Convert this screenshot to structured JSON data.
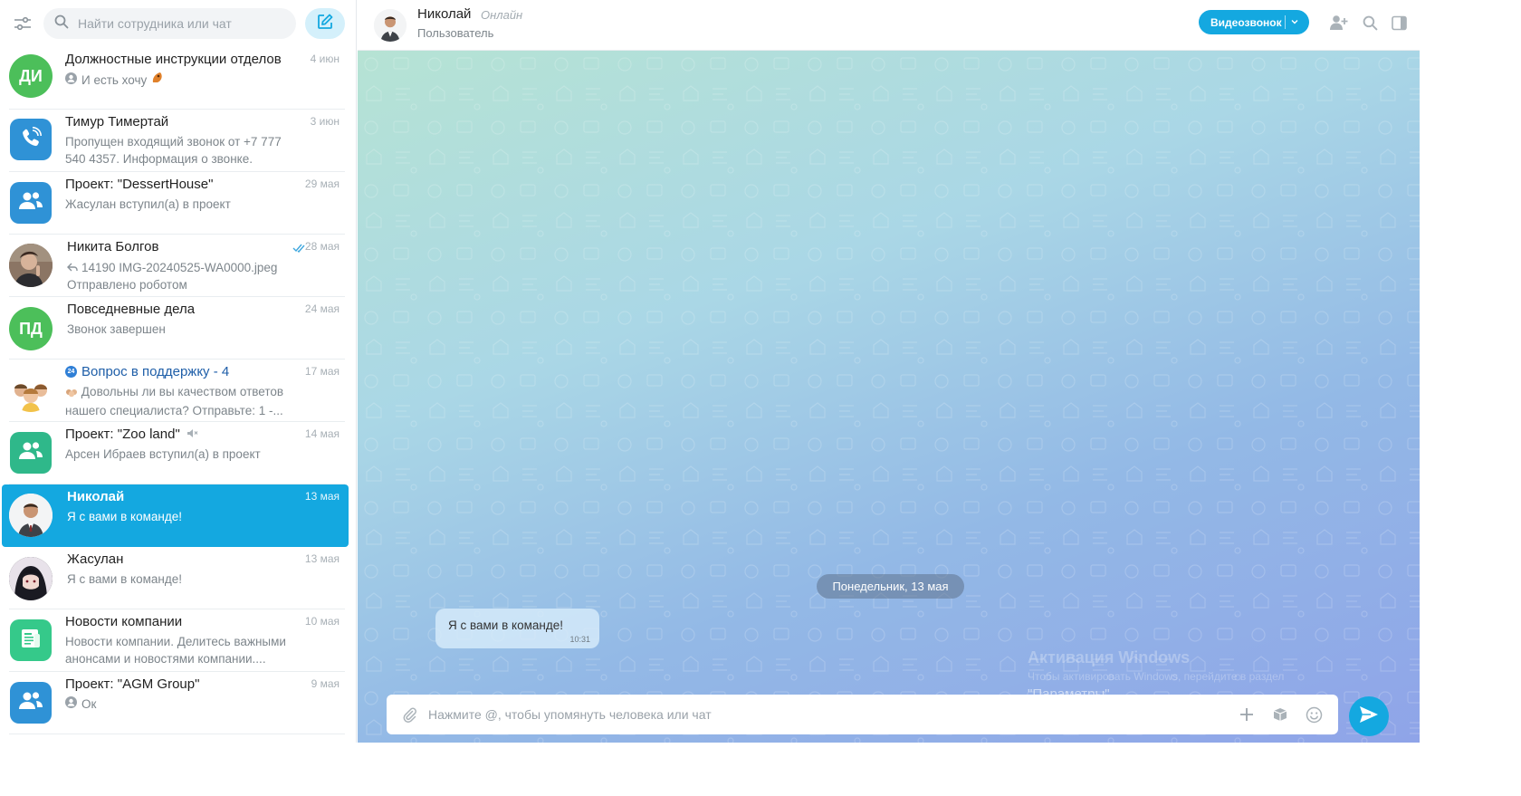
{
  "sidebar": {
    "search_placeholder": "Найти сотрудника или чат",
    "chats": [
      {
        "title": "Должностные инструкции отделов",
        "date": "4 июн",
        "text": "И есть хочу",
        "avatar_text": "ДИ",
        "avatar_color": "#4cbf5a"
      },
      {
        "title": "Тимур Тимертай",
        "date": "3 июн",
        "text": "Пропущен входящий звонок от +7 777 540 4357. Информация о звонке.",
        "avatar_color": "#2f92d6"
      },
      {
        "title": "Проект: \"DessertHouse\"",
        "date": "29 мая",
        "text": "Жасулан вступил(а) в проект",
        "avatar_color": "#2f92d6"
      },
      {
        "title": "Никита Болгов",
        "date": "28 мая",
        "text": "14190 IMG-20240525-WA0000.jpeg",
        "text2": "Отправлено роботом"
      },
      {
        "title": "Повседневные дела",
        "date": "24 мая",
        "text": "Звонок завершен",
        "avatar_text": "ПД",
        "avatar_color": "#4cbf5a"
      },
      {
        "title": "Вопрос в поддержку - 4",
        "date": "17 мая",
        "text": "Довольны ли вы качеством ответов нашего специалиста? Отправьте: 1 -...",
        "badge": "24"
      },
      {
        "title": "Проект: \"Zoo land\"",
        "date": "14 мая",
        "text": "Арсен Ибраев вступил(а) в проект",
        "avatar_color": "#2fb88a"
      },
      {
        "title": "Николай",
        "date": "13 мая",
        "text": "Я с вами в команде!"
      },
      {
        "title": "Жасулан",
        "date": "13 мая",
        "text": "Я с вами в команде!"
      },
      {
        "title": "Новости компании",
        "date": "10 мая",
        "text": "Новости компании. Делитесь важными анонсами и новостями компании....",
        "avatar_color": "#35c98a"
      },
      {
        "title": "Проект: \"AGM Group\"",
        "date": "9 мая",
        "text": "Ок",
        "avatar_color": "#2f92d6"
      }
    ]
  },
  "header": {
    "name": "Николай",
    "status": "Онлайн",
    "role": "Пользователь",
    "video_label": "Видеозвонок"
  },
  "chat": {
    "date_pill": "Понедельник, 13 мая",
    "message_text": "Я с вами в команде!",
    "message_time": "10:31",
    "composer_placeholder": "Нажмите @, чтобы упомянуть человека или чат"
  },
  "watermark": {
    "title": "Активация Windows",
    "line": "Чтобы активировать Windows, перейдите в раздел",
    "params": "\"Параметры\"."
  },
  "colors": {
    "accent": "#14a8e0",
    "online_status": "#a3abb1",
    "green_avatar": "#4cbf5a",
    "blue_avatar": "#2f92d6"
  }
}
